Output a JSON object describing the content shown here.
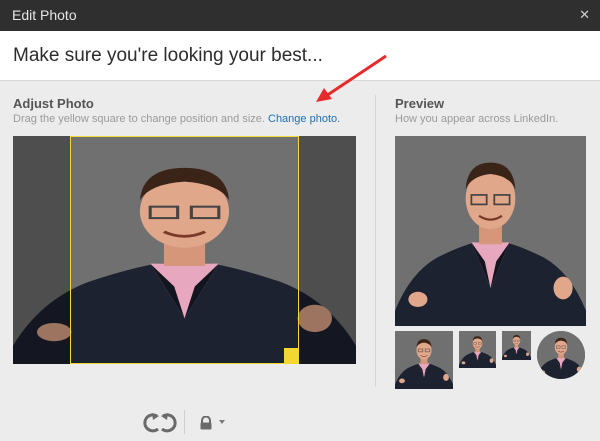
{
  "window": {
    "title": "Edit Photo",
    "close_icon": "close-icon"
  },
  "header": {
    "heading": "Make sure you're looking your best..."
  },
  "adjust": {
    "title": "Adjust Photo",
    "instructions": "Drag the yellow square to change position and size.",
    "change_link": "Change photo."
  },
  "preview": {
    "title": "Preview",
    "subtitle": "How you appear across LinkedIn."
  },
  "toolbar": {
    "rotate_icon": "rotate-icon",
    "lock_icon": "lock-icon"
  },
  "colors": {
    "crop": "#f3d733",
    "link": "#1f6fb2",
    "arrow": "#e52b2b",
    "titlebar": "#2f2f2f"
  }
}
